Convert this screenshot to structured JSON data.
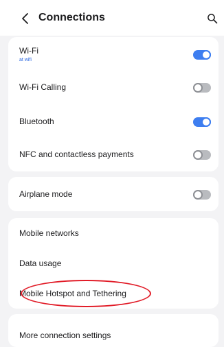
{
  "header": {
    "back_icon": "chevron-left-icon",
    "title": "Connections",
    "search_icon": "search-icon"
  },
  "group1": {
    "wifi": {
      "label": "Wi-Fi",
      "sub": "at wifi",
      "state": "on"
    },
    "wifi_calling": {
      "label": "Wi-Fi Calling",
      "state": "off"
    },
    "bluetooth": {
      "label": "Bluetooth",
      "state": "on"
    },
    "nfc": {
      "label": "NFC and contactless payments",
      "state": "off"
    }
  },
  "group2": {
    "airplane": {
      "label": "Airplane mode",
      "state": "off"
    }
  },
  "group3": {
    "mobile_networks": {
      "label": "Mobile networks"
    },
    "data_usage": {
      "label": "Data usage"
    },
    "hotspot": {
      "label": "Mobile Hotspot and Tethering",
      "highlighted": true
    }
  },
  "group4": {
    "more_settings": {
      "label": "More connection settings"
    }
  },
  "colors": {
    "toggle_on": "#3e7ef0",
    "toggle_off": "#b9bbbf",
    "highlight_ring": "#e11b27",
    "subtext": "#2a67e0"
  }
}
